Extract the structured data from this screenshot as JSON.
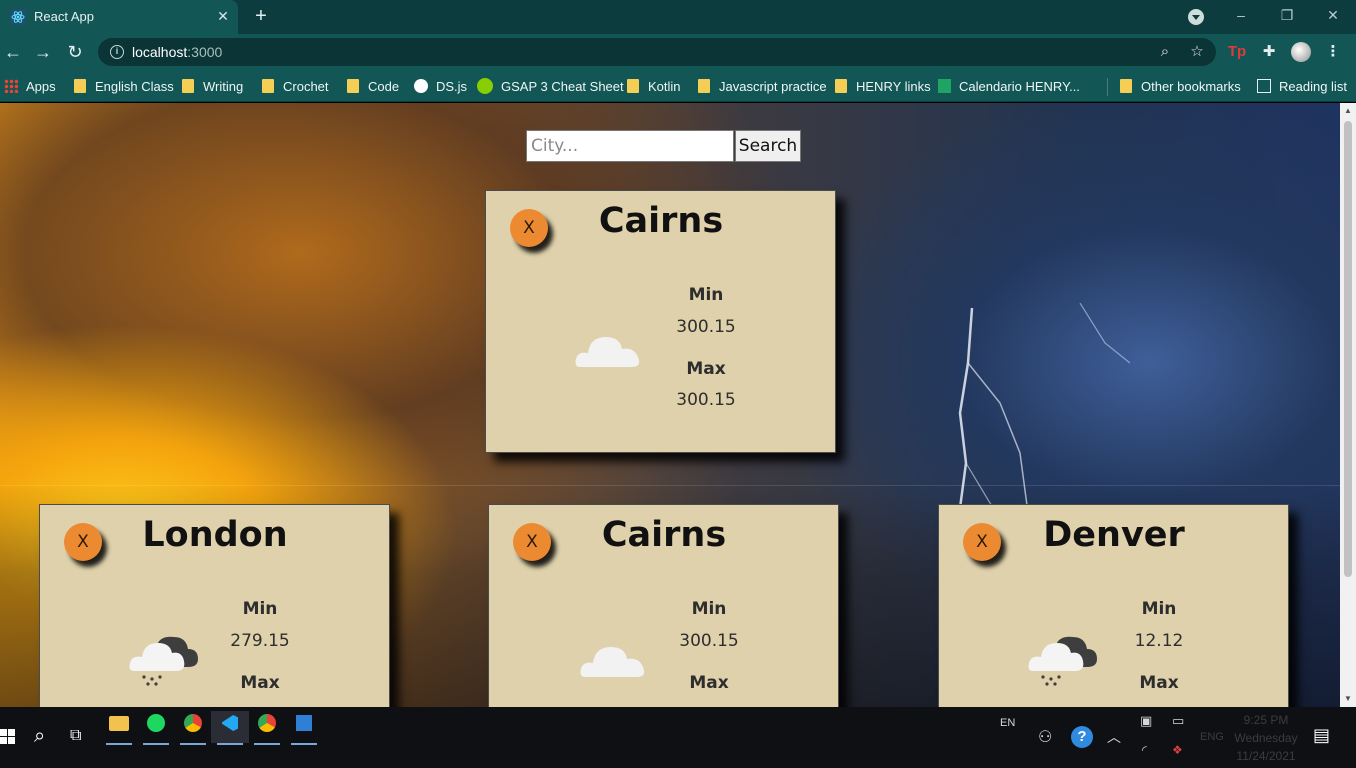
{
  "browser": {
    "tab_title": "React App",
    "tab_close": "✕",
    "new_tab": "+",
    "url_host": "localhost",
    "url_port": ":3000",
    "window_controls": [
      "–",
      "❐",
      "✕"
    ]
  },
  "bookmarks": [
    {
      "label": "Apps",
      "icon": "apps"
    },
    {
      "label": "English Class",
      "icon": "folder"
    },
    {
      "label": "Writing",
      "icon": "folder"
    },
    {
      "label": "Crochet",
      "icon": "folder"
    },
    {
      "label": "Code",
      "icon": "folder"
    },
    {
      "label": "DS.js",
      "icon": "globe"
    },
    {
      "label": "GSAP 3 Cheat Sheet",
      "icon": "gsap"
    },
    {
      "label": "Kotlin",
      "icon": "folder"
    },
    {
      "label": "Javascript practice",
      "icon": "folder"
    },
    {
      "label": "HENRY links",
      "icon": "folder"
    },
    {
      "label": "Calendario HENRY...",
      "icon": "sheet"
    },
    {
      "label": "Other bookmarks",
      "icon": "folder"
    },
    {
      "label": "Reading list",
      "icon": "list"
    }
  ],
  "search": {
    "placeholder": "City...",
    "button": "Search"
  },
  "cards": {
    "featured": {
      "city": "Cairns",
      "close": "X",
      "min_label": "Min",
      "min": "300.15",
      "max_label": "Max",
      "max": "300.15",
      "icon": "cloud-icon"
    },
    "list": [
      {
        "city": "London",
        "close": "X",
        "min_label": "Min",
        "min": "279.15",
        "max_label": "Max",
        "icon": "rain-cloud-icon"
      },
      {
        "city": "Cairns",
        "close": "X",
        "min_label": "Min",
        "min": "300.15",
        "max_label": "Max",
        "icon": "cloud-icon"
      },
      {
        "city": "Denver",
        "close": "X",
        "min_label": "Min",
        "min": "12.12",
        "max_label": "Max",
        "icon": "rain-cloud-icon"
      }
    ]
  },
  "taskbar": {
    "language": "EN",
    "keyboard": "ENG",
    "time": "9:25 PM",
    "day": "Wednesday",
    "date": "11/24/2021"
  },
  "colors": {
    "card_bg": "#dfd1ab",
    "close_button": "#ec8a32",
    "browser_frame": "#125656"
  }
}
